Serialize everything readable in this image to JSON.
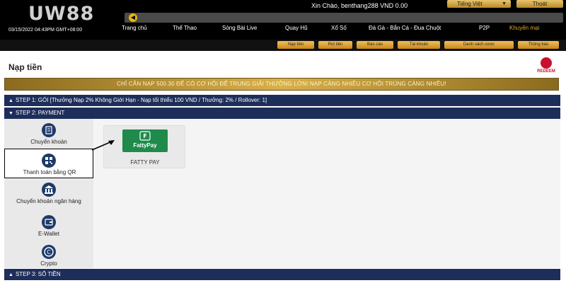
{
  "header": {
    "logo": "UW88",
    "greeting": "Xin Chào, benthang288 VND 0.00",
    "language_label": "Tiếng Việt",
    "logout_label": "Thoát",
    "datetime": "03/15/2022 04:43PM GMT+08:00"
  },
  "main_nav": [
    "Trang chủ",
    "Thể Thao",
    "Sòng Bài Live",
    "Quay Hũ",
    "Xổ Số",
    "Đá Gà - Bắn Cá - Đua Chuột",
    "P2P",
    "Khuyến mại"
  ],
  "sub_nav": [
    "Nạp tiền",
    "Rút tiền",
    "Báo cáo",
    "Tài khoản",
    "Danh sách cược",
    "Thông báo"
  ],
  "page": {
    "title": "Nạp tiền",
    "redeem_label": "REDEEM",
    "promo_banner": "CHỈ CẦN NẠP 500.30 ĐỂ CÓ CƠ HỘI ĐỂ TRUNG GIẢI THƯỞNG LỚN! NẠP CÀNG NHIỀU CƠ HỘI TRÚNG CÀNG NHIỀU!"
  },
  "steps": {
    "step1": "STEP 1: GÓI [Thưởng Nạp 2% Không Giới Hạn - Nạp tối thiểu 100 VND / Thưởng: 2% / Rollover: 1]",
    "step2": "STEP 2: PAYMENT",
    "step3": "STEP 3: SỐ TIỀN"
  },
  "payment_methods": [
    {
      "label": "Chuyển khoản",
      "icon": "bank-transfer-icon"
    },
    {
      "label": "Thanh toán bằng QR",
      "icon": "qr-code-icon",
      "selected": true
    },
    {
      "label": "Chuyển khoản ngân hàng",
      "icon": "bank-icon"
    },
    {
      "label": "E-Wallet",
      "icon": "wallet-icon"
    },
    {
      "label": "Crypto",
      "icon": "crypto-icon"
    }
  ],
  "provider": {
    "logo_text": "FattyPay",
    "name": "FATTY PAY"
  },
  "colors": {
    "header_bg": "#000000",
    "gold": "#e2a62d",
    "step_bar": "#1e2e5a",
    "provider_green": "#1f8a4c",
    "redeem_red": "#c8102e"
  }
}
